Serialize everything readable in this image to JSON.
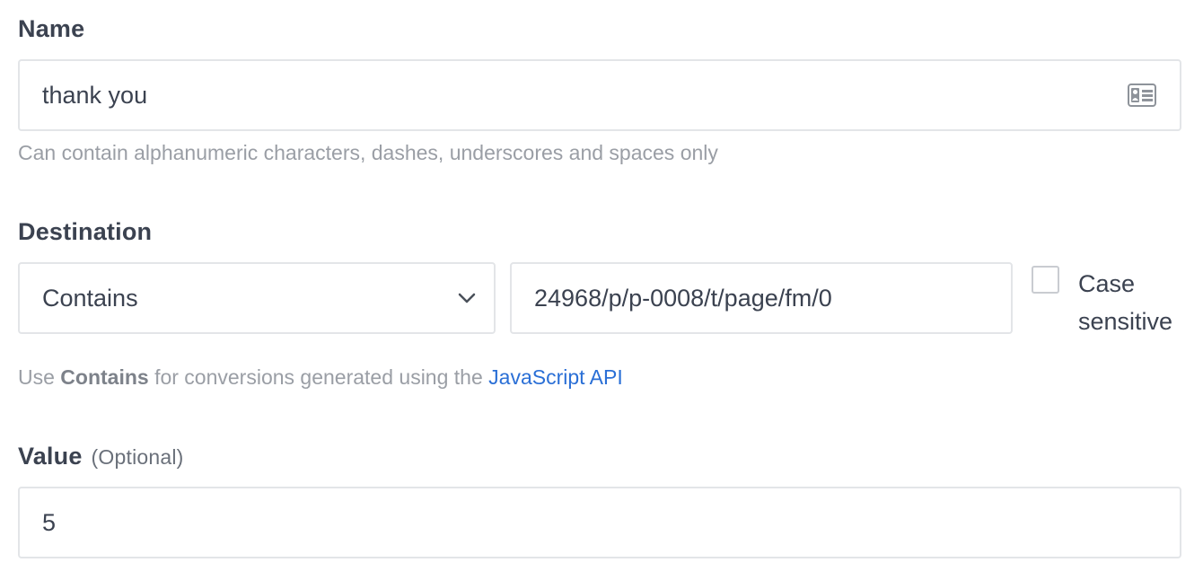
{
  "name_field": {
    "label": "Name",
    "value": "thank you",
    "help": "Can contain alphanumeric characters, dashes, underscores and spaces only",
    "icon": "contact-card-icon"
  },
  "destination": {
    "label": "Destination",
    "match_type": "Contains",
    "path_value": "24968/p/p-0008/t/page/fm/0",
    "case_sensitive_label": "Case sensitive",
    "case_sensitive_checked": false,
    "help_prefix": "Use ",
    "help_bold": "Contains",
    "help_middle": " for conversions generated using the ",
    "help_link": "JavaScript API"
  },
  "value_field": {
    "label": "Value",
    "optional": "(Optional)",
    "value": "5"
  },
  "colors": {
    "link": "#2a6fd6",
    "border": "#e3e5e8",
    "text": "#3b4250",
    "muted": "#9a9ea5"
  }
}
